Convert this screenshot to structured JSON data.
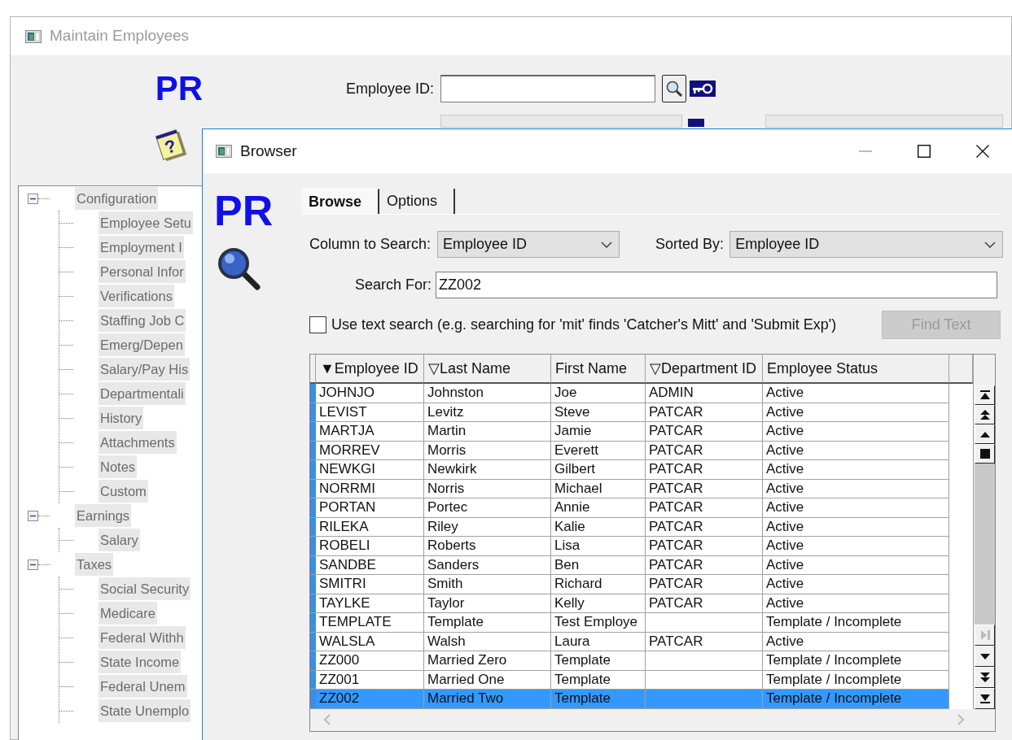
{
  "main_window": {
    "title": "Maintain Employees",
    "logo": "PR",
    "help_glyph": "?",
    "employee_id": {
      "label": "Employee ID:"
    }
  },
  "tree": [
    {
      "label": "Configuration",
      "expanded": true,
      "children": [
        {
          "label": "Employee Setu"
        },
        {
          "label": "Employment I"
        },
        {
          "label": "Personal Infor"
        },
        {
          "label": "Verifications"
        },
        {
          "label": "Staffing Job C"
        },
        {
          "label": "Emerg/Depen"
        },
        {
          "label": "Salary/Pay His"
        },
        {
          "label": "Departmentali"
        },
        {
          "label": "History"
        },
        {
          "label": "Attachments"
        },
        {
          "label": "Notes"
        },
        {
          "label": "Custom"
        }
      ]
    },
    {
      "label": "Earnings",
      "expanded": true,
      "children": [
        {
          "label": "Salary"
        }
      ]
    },
    {
      "label": "Taxes",
      "expanded": true,
      "children": [
        {
          "label": "Social Security"
        },
        {
          "label": "Medicare"
        },
        {
          "label": "Federal Withh"
        },
        {
          "label": "State Income"
        },
        {
          "label": "Federal Unem"
        },
        {
          "label": "State Unemplo"
        }
      ]
    }
  ],
  "browser": {
    "title": "Browser",
    "logo": "PR",
    "tabs": [
      {
        "label": "Browse",
        "selected": true
      },
      {
        "label": "Options",
        "selected": false
      }
    ],
    "column_to_search": {
      "label": "Column to Search:",
      "value": "Employee ID"
    },
    "sorted_by": {
      "label": "Sorted By:",
      "value": "Employee ID"
    },
    "search_for": {
      "label": "Search For:",
      "value": "ZZ002"
    },
    "text_search": {
      "label": "Use text search (e.g. searching for 'mit' finds 'Catcher's Mitt' and 'Submit Exp')",
      "checked": false
    },
    "find_button": {
      "label": "Find Text",
      "disabled": true
    },
    "table": {
      "columns": [
        "▼Employee ID",
        "▽Last Name",
        "First Name",
        "▽Department ID",
        "Employee Status"
      ],
      "rows": [
        {
          "employee_id": "JOHNJO",
          "last_name": "Johnston",
          "first_name": "Joe",
          "department_id": "ADMIN",
          "status": "Active",
          "selected": false
        },
        {
          "employee_id": "LEVIST",
          "last_name": "Levitz",
          "first_name": "Steve",
          "department_id": "PATCAR",
          "status": "Active",
          "selected": false
        },
        {
          "employee_id": "MARTJA",
          "last_name": "Martin",
          "first_name": "Jamie",
          "department_id": "PATCAR",
          "status": "Active",
          "selected": false
        },
        {
          "employee_id": "MORREV",
          "last_name": "Morris",
          "first_name": "Everett",
          "department_id": "PATCAR",
          "status": "Active",
          "selected": false
        },
        {
          "employee_id": "NEWKGI",
          "last_name": "Newkirk",
          "first_name": "Gilbert",
          "department_id": "PATCAR",
          "status": "Active",
          "selected": false
        },
        {
          "employee_id": "NORRMI",
          "last_name": "Norris",
          "first_name": "Michael",
          "department_id": "PATCAR",
          "status": "Active",
          "selected": false
        },
        {
          "employee_id": "PORTAN",
          "last_name": "Portec",
          "first_name": "Annie",
          "department_id": "PATCAR",
          "status": "Active",
          "selected": false
        },
        {
          "employee_id": "RILEKA",
          "last_name": "Riley",
          "first_name": "Kalie",
          "department_id": "PATCAR",
          "status": "Active",
          "selected": false
        },
        {
          "employee_id": "ROBELI",
          "last_name": "Roberts",
          "first_name": "Lisa",
          "department_id": "PATCAR",
          "status": "Active",
          "selected": false
        },
        {
          "employee_id": "SANDBE",
          "last_name": "Sanders",
          "first_name": "Ben",
          "department_id": "PATCAR",
          "status": "Active",
          "selected": false
        },
        {
          "employee_id": "SMITRI",
          "last_name": "Smith",
          "first_name": "Richard",
          "department_id": "PATCAR",
          "status": "Active",
          "selected": false
        },
        {
          "employee_id": "TAYLKE",
          "last_name": "Taylor",
          "first_name": "Kelly",
          "department_id": "PATCAR",
          "status": "Active",
          "selected": false
        },
        {
          "employee_id": "TEMPLATE",
          "last_name": "Template",
          "first_name": "Test Employe",
          "status": "Template / Incomplete",
          "selected": false
        },
        {
          "employee_id": "WALSLA",
          "last_name": "Walsh",
          "first_name": "Laura",
          "department_id": "PATCAR",
          "status": "Active",
          "selected": false
        },
        {
          "employee_id": "ZZ000",
          "last_name": "Married Zero",
          "first_name": "Template",
          "status": "Template / Incomplete",
          "selected": false
        },
        {
          "employee_id": "ZZ001",
          "last_name": "Married One",
          "first_name": "Template",
          "status": "Template / Incomplete",
          "selected": false
        },
        {
          "employee_id": "ZZ002",
          "last_name": "Married Two",
          "first_name": "Template",
          "status": "Template / Incomplete",
          "selected": true
        }
      ]
    }
  }
}
